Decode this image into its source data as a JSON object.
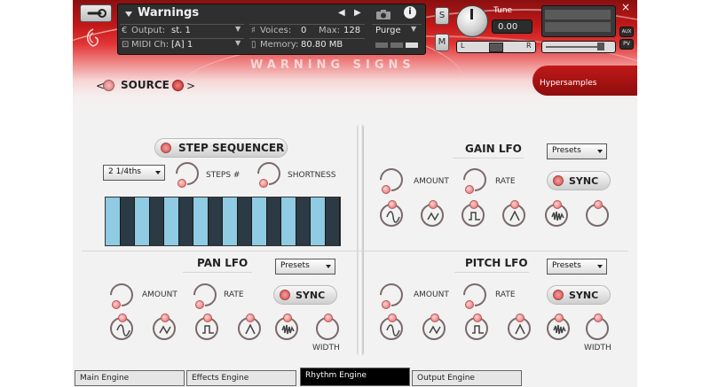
{
  "header": {
    "instrument_name": "Warnings",
    "output_label": "Output:",
    "output_value": "st. 1",
    "midi_label": "MIDI Ch:",
    "midi_value": "[A]  1",
    "voices_label": "Voices:",
    "voices_value": "0",
    "max_label": "Max:",
    "max_value": "128",
    "memory_label": "Memory:",
    "memory_value": "80.80 MB",
    "purge_label": "Purge",
    "solo_label": "S",
    "mute_label": "M",
    "tune_label": "Tune",
    "tune_value": "0.00",
    "pan_left": "L",
    "pan_right": "R",
    "aux_label": "AUX",
    "pv_label": "PV",
    "close_glyph": "×"
  },
  "banner": {
    "title": "WARNING SIGNS",
    "brand": "Hypersamples"
  },
  "source": {
    "prev": "<",
    "label": "SOURCE",
    "next": ">"
  },
  "step_sequencer": {
    "title": "STEP SEQUENCER",
    "rate_value": "2 1/4ths",
    "steps_label": "STEPS #",
    "shortness_label": "SHORTNESS",
    "steps": [
      1,
      0,
      1,
      0,
      1,
      0,
      1,
      0,
      1,
      0,
      1,
      0,
      1,
      0,
      1,
      0
    ]
  },
  "gain_lfo": {
    "title": "GAIN LFO",
    "presets_label": "Presets",
    "amount_label": "AMOUNT",
    "rate_label": "RATE",
    "sync_label": "SYNC"
  },
  "pan_lfo": {
    "title": "PAN LFO",
    "presets_label": "Presets",
    "amount_label": "AMOUNT",
    "rate_label": "RATE",
    "sync_label": "SYNC",
    "width_label": "WIDTH"
  },
  "pitch_lfo": {
    "title": "PITCH LFO",
    "presets_label": "Presets",
    "amount_label": "AMOUNT",
    "rate_label": "RATE",
    "sync_label": "SYNC",
    "width_label": "WIDTH"
  },
  "tabs": [
    {
      "label": "Main Engine"
    },
    {
      "label": "Effects Engine"
    },
    {
      "label": "Rhythm Engine"
    },
    {
      "label": "Output Engine"
    }
  ],
  "colors": {
    "brand_red": "#c21818",
    "step_on": "#8fcbe2",
    "step_off": "#2b3a44",
    "led": "#d24a4a"
  }
}
